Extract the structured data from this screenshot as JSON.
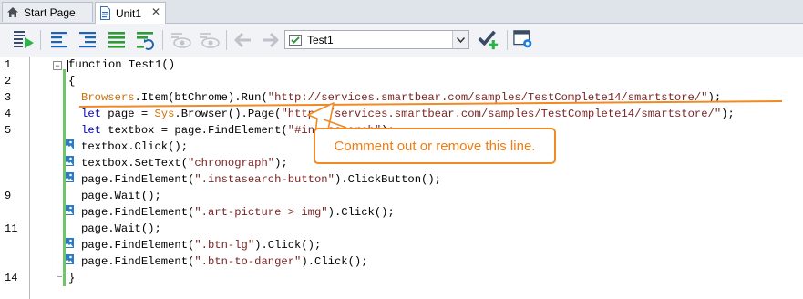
{
  "tabs": [
    {
      "label": "Start Page",
      "icon": "home-icon",
      "active": false
    },
    {
      "label": "Unit1",
      "icon": "unit-file-icon",
      "active": true,
      "close": "✕"
    }
  ],
  "toolbar": {
    "run_test": "run-test-icon",
    "routine_combo_value": "Test1"
  },
  "editor": {
    "line_numbers": [
      "1",
      "2",
      "3",
      "4",
      "5",
      "9",
      "11",
      "14"
    ],
    "fold_glyph": "−",
    "lines": [
      {
        "text": "function Test1()"
      },
      {
        "text": "{"
      },
      {
        "obj": "Browsers",
        "p1": ".Item(btChrome).Run(",
        "str": "\"http://services.smartbear.com/samples/TestComplete14/smartstore/\"",
        "p2": ");"
      },
      {
        "kw": "let",
        "p1": " page = ",
        "obj": "Sys",
        "p2": ".Browser().Page(",
        "str": "\"http://services.smartbear.com/samples/TestComplete14/smartstore/\"",
        "p3": ");"
      },
      {
        "kw": "let",
        "p1": " textbox = page.FindElement(",
        "str": "\"#instasearch\"",
        "p2": ");"
      },
      {
        "text": "textbox.Click();"
      },
      {
        "p1": "textbox.SetText(",
        "str": "\"chronograph\"",
        "p2": ");"
      },
      {
        "p1": "page.FindElement(",
        "str": "\".instasearch-button\"",
        "p2": ").ClickButton();"
      },
      {
        "text": "page.Wait();"
      },
      {
        "p1": "page.FindElement(",
        "str": "\".art-picture > img\"",
        "p2": ").Click();"
      },
      {
        "text": "page.Wait();"
      },
      {
        "p1": "page.FindElement(",
        "str": "\".btn-lg\"",
        "p2": ").Click();"
      },
      {
        "p1": "page.FindElement(",
        "str": "\".btn-to-danger\"",
        "p2": ").Click();"
      },
      {
        "text": "}"
      }
    ]
  },
  "callout": {
    "text": "Comment out or remove this line.",
    "color": "#f07d14"
  },
  "colors": {
    "keyword": "#0000c0",
    "object": "#c8720c",
    "string": "#7a2424",
    "change_bar": "#72c36d",
    "annotation": "#f08a24"
  }
}
